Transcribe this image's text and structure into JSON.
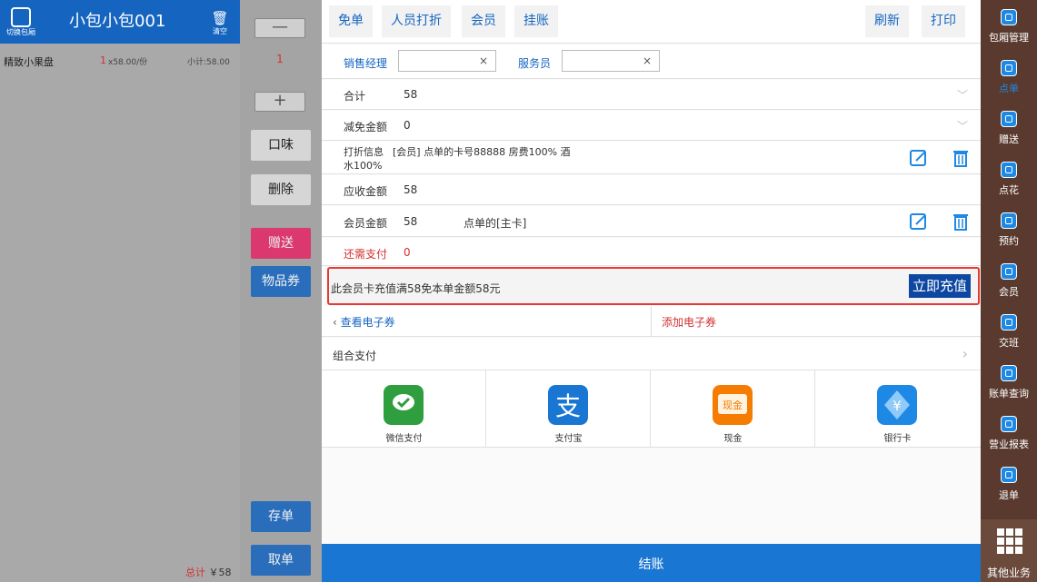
{
  "left": {
    "switch_room_label": "切换包厢",
    "room_name": "小包小包001",
    "clear_label": "清空",
    "order": {
      "name": "精致小果盘",
      "qty": "1",
      "price": "x58.00/份",
      "subtotal": "小计:58.00"
    },
    "total_label": "总计",
    "total_value": "￥58"
  },
  "mid": {
    "minus": "—",
    "qty": "1",
    "plus": "+",
    "flavor": "口味",
    "delete": "删除",
    "gift": "赠送",
    "voucher": "物品券",
    "save_order": "存单",
    "take_order": "取单"
  },
  "topbar": {
    "free": "免单",
    "staff_discount": "人员打折",
    "member": "会员",
    "hang": "挂账",
    "refresh": "刷新",
    "print": "打印"
  },
  "staff": {
    "sales_manager_label": "销售经理",
    "sales_manager_value": "",
    "waiter_label": "服务员",
    "waiter_value": ""
  },
  "summary": {
    "total_label": "合计",
    "total_value": "58",
    "reduction_label": "减免金额",
    "reduction_value": "0",
    "discount_label": "打折信息",
    "discount_value_line1": "[会员] 点单的卡号88888 房费100% 酒",
    "discount_value_line2": "水100%",
    "receivable_label": "应收金额",
    "receivable_value": "58",
    "member_amount_label": "会员金额",
    "member_amount_value": "58",
    "member_card": "点单的[主卡]",
    "due_label": "还需支付",
    "due_value": "0"
  },
  "promo": {
    "text": "此会员卡充值满58免本单金额58元",
    "button": "立即充值"
  },
  "coupon": {
    "view": "查看电子券",
    "add": "添加电子券"
  },
  "combo_pay_label": "组合支付",
  "payments": [
    {
      "label": "微信支付",
      "icon": "wechat-pay-icon",
      "color": "#2e9e3e"
    },
    {
      "label": "支付宝",
      "icon": "alipay-icon",
      "color": "#1976d2"
    },
    {
      "label": "现金",
      "icon": "cash-icon",
      "color": "#f57c00"
    },
    {
      "label": "银行卡",
      "icon": "bank-card-icon",
      "color": "#1e88e5"
    }
  ],
  "checkout_label": "结账",
  "nav": [
    {
      "label": "包厢管理",
      "icon": "room-manage-icon"
    },
    {
      "label": "点单",
      "icon": "order-icon"
    },
    {
      "label": "赠送",
      "icon": "gift-icon"
    },
    {
      "label": "点花",
      "icon": "flower-icon"
    },
    {
      "label": "预约",
      "icon": "reservation-icon"
    },
    {
      "label": "会员",
      "icon": "member-icon"
    },
    {
      "label": "交班",
      "icon": "shift-icon"
    },
    {
      "label": "账单查询",
      "icon": "bill-query-icon"
    },
    {
      "label": "营业报表",
      "icon": "report-icon"
    },
    {
      "label": "退单",
      "icon": "refund-icon"
    }
  ],
  "other_business": "其他业务",
  "colors": {
    "brand_blue": "#1565c0",
    "accent_red": "#d32f2f",
    "nav_bg": "#5a3a2e"
  }
}
